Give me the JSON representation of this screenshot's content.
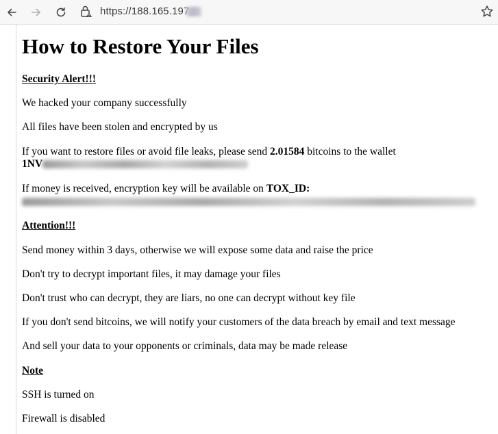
{
  "browser": {
    "url_text": "https://188.165.197."
  },
  "page": {
    "title": "How to Restore Your Files",
    "security_heading": "Security Alert!!!",
    "line_hacked": "We hacked your company successfully",
    "line_stolen": "All files have been stolen and encrypted by us",
    "restore_prefix": "If you want to restore files or avoid file leaks, please send ",
    "btc_amount": "2.01584",
    "restore_suffix": " bitcoins to the wallet",
    "wallet_prefix": "1NV",
    "money_prefix": "If money is received, encryption key will be available on ",
    "tox_label": "TOX_ID:",
    "attention_heading": "Attention!!!",
    "line_send_money": "Send money within 3 days, otherwise we will expose some data and raise the price",
    "line_dont_decrypt": "Don't try to decrypt important files, it may damage your files",
    "line_dont_trust": "Don't trust who can decrypt, they are liars, no one can decrypt without key file",
    "line_notify": "If you don't send bitcoins, we will notify your customers of the data breach by email and text message",
    "line_sell": "And sell your data to your opponents or criminals, data may be made release",
    "note_heading": "Note",
    "line_ssh": "SSH is turned on",
    "line_firewall": "Firewall is disabled"
  }
}
